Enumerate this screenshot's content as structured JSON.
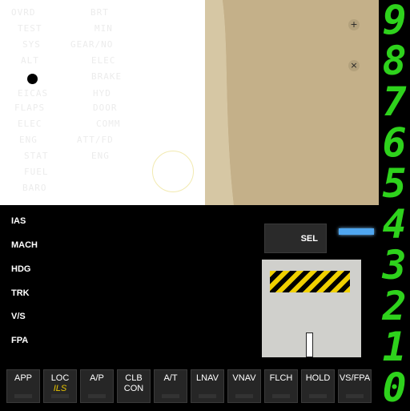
{
  "panel_labels": [
    "IAS",
    "MACH",
    "HDG",
    "TRK",
    "V/S",
    "FPA"
  ],
  "sel_label": "SEL",
  "bottom_buttons": [
    {
      "label": "APP",
      "sub": ""
    },
    {
      "label": "LOC",
      "sub": "ILS"
    },
    {
      "label": "A/P",
      "sub": ""
    },
    {
      "label": "CLB\nCON",
      "sub": ""
    },
    {
      "label": "A/T",
      "sub": ""
    },
    {
      "label": "LNAV",
      "sub": ""
    },
    {
      "label": "VNAV",
      "sub": ""
    },
    {
      "label": "FLCH",
      "sub": ""
    },
    {
      "label": "HOLD",
      "sub": ""
    },
    {
      "label": "VS/FPA",
      "sub": ""
    }
  ],
  "digits": [
    "9",
    "8",
    "7",
    "6",
    "5",
    "4",
    "3",
    "2",
    "1",
    "0"
  ],
  "faint_left": [
    "OVRD",
    "TEST",
    "SYS",
    "ALT",
    "",
    "EICAS",
    "FLAPS",
    "ELEC",
    "ENG",
    "STAT",
    "FUEL",
    "BARO"
  ],
  "faint_right": [
    "BRT",
    "MIN",
    "GEAR/NO",
    "ELEC",
    "BRAKE",
    "HYD",
    "DOOR",
    "COMM",
    "ATT/FD",
    "ENG"
  ],
  "screws": [
    "+",
    "×"
  ],
  "colors": {
    "digit_green": "#2ed21c",
    "beige": "#c2ad84",
    "hazard_yellow": "#f0d000",
    "sel_blue": "#4fa6f0",
    "sub_yellow": "#e8c400"
  }
}
